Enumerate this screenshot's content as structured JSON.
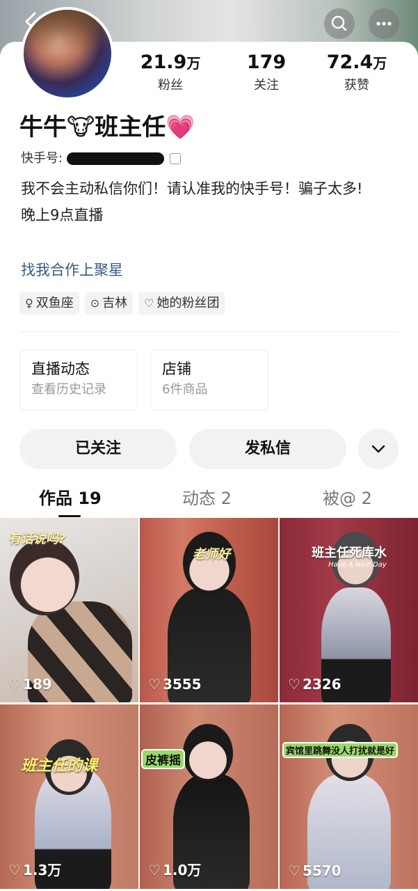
{
  "header": {
    "back_icon": "chevron-left-icon",
    "search_icon": "search-icon",
    "more_icon": "more-dots-icon"
  },
  "profile": {
    "name": "牛牛🐮班主任💗",
    "id_label": "快手号:",
    "stats": [
      {
        "value": "21.9",
        "unit": "万",
        "label": "粉丝"
      },
      {
        "value": "179",
        "unit": "",
        "label": "关注"
      },
      {
        "value": "72.4",
        "unit": "万",
        "label": "获赞"
      }
    ],
    "bio_lines": [
      "我不会主动私信你们！请认准我的快手号！骗子太多!",
      "晚上9点直播"
    ],
    "bio_link": "找我合作上聚星",
    "tags": [
      {
        "icon": "female-icon",
        "text": "双鱼座"
      },
      {
        "icon": "location-icon",
        "text": "吉林"
      },
      {
        "icon": "fan-group-icon",
        "text": "她的粉丝团"
      }
    ]
  },
  "cards": [
    {
      "title": "直播动态",
      "subtitle": "查看历史记录"
    },
    {
      "title": "店铺",
      "subtitle": "6件商品"
    }
  ],
  "actions": {
    "follow_label": "已关注",
    "message_label": "发私信",
    "more_icon": "chevron-down-icon"
  },
  "tabs": [
    {
      "label": "作品 19",
      "active": true
    },
    {
      "label": "动态 2",
      "active": false
    },
    {
      "label": "被@ 2",
      "active": false
    }
  ],
  "videos": [
    {
      "caption": "有话说吗?",
      "likes": "189"
    },
    {
      "caption": "老师好",
      "likes": "3555"
    },
    {
      "caption": "班主任死库水",
      "subcaption": "Have A Nice Day",
      "likes": "2326"
    },
    {
      "caption": "班主任的课",
      "likes": "1.3万"
    },
    {
      "caption": "皮裤摇",
      "likes": "1.0万"
    },
    {
      "caption": "宾馆里跳舞没人打扰就是好",
      "likes": "5570"
    }
  ]
}
